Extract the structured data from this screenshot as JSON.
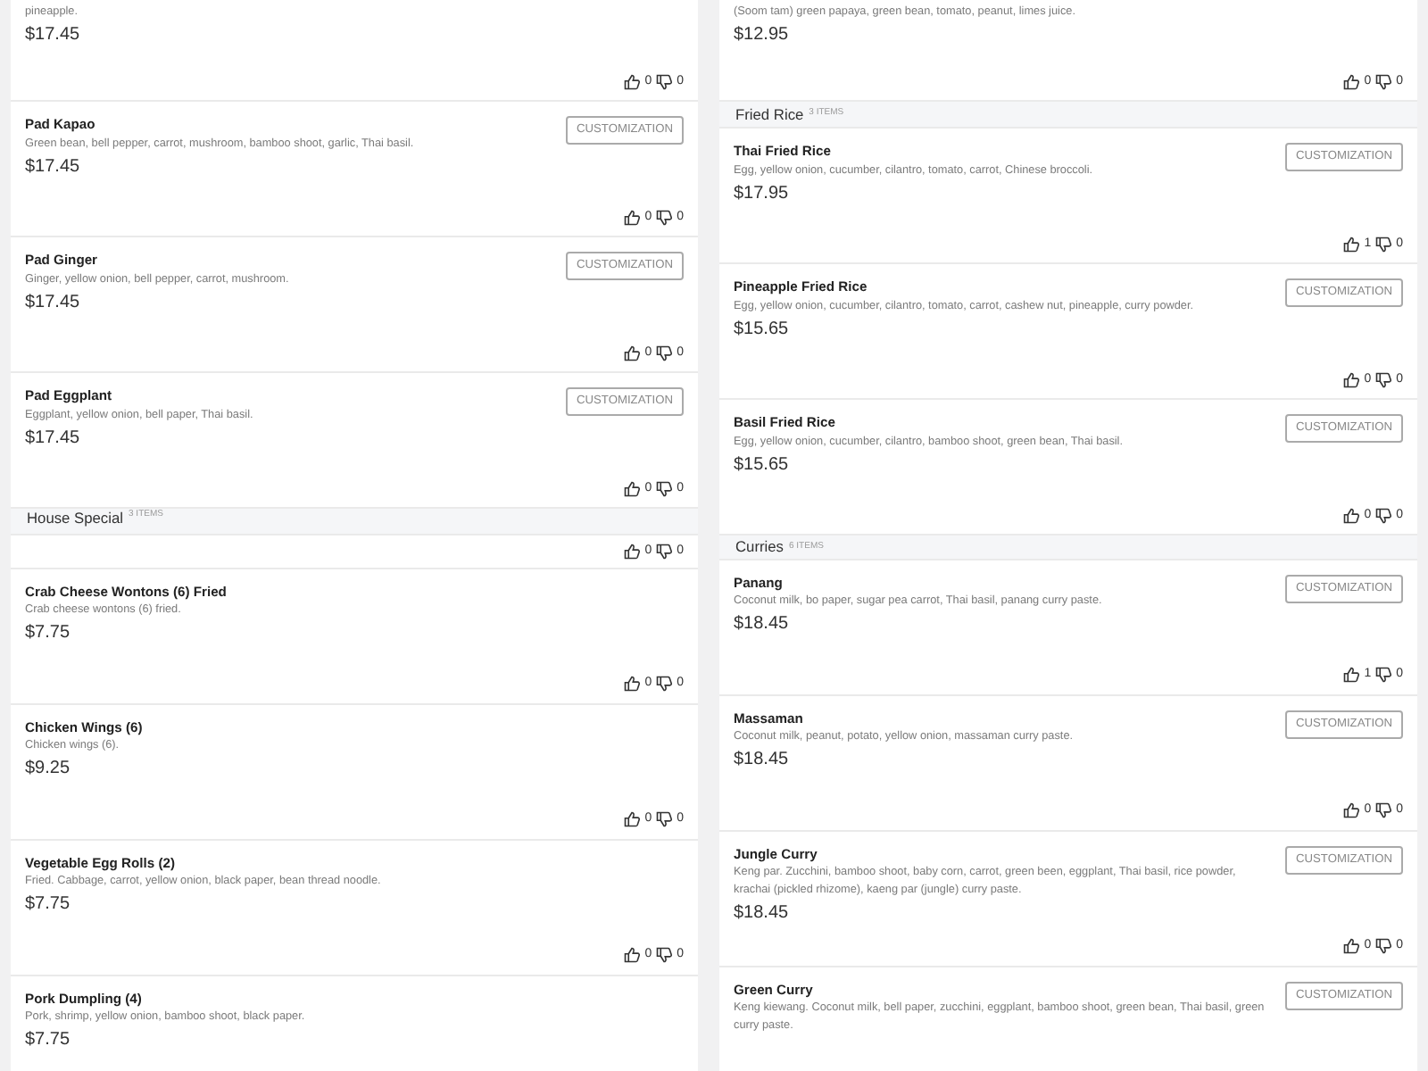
{
  "columns": [
    {
      "panels": [
        {
          "rows": [
            {
              "kind": "item",
              "description": "pineapple.",
              "price": "$17.45",
              "likes": "0",
              "dislikes": "0"
            },
            {
              "kind": "item",
              "name": "Pad Kapao",
              "description": "Green bean, bell pepper, carrot, mushroom, bamboo shoot, garlic, Thai basil.",
              "price": "$17.45",
              "button": "CUSTOMIZATION",
              "likes": "0",
              "dislikes": "0"
            },
            {
              "kind": "item",
              "name": "Pad Ginger",
              "description": "Ginger, yellow onion, bell pepper, carrot, mushroom.",
              "price": "$17.45",
              "button": "CUSTOMIZATION",
              "likes": "0",
              "dislikes": "0"
            },
            {
              "kind": "item",
              "name": "Pad Eggplant",
              "description": "Eggplant, yellow onion, bell paper, Thai basil.",
              "price": "$17.45",
              "button": "CUSTOMIZATION",
              "likes": "0",
              "dislikes": "0"
            },
            {
              "kind": "header",
              "title": "House Special",
              "count": "3 ITEMS"
            }
          ]
        },
        {
          "rows": [
            {
              "kind": "item",
              "likes": "0",
              "dislikes": "0"
            },
            {
              "kind": "item",
              "name": "Crab Cheese Wontons (6) Fried",
              "description": "Crab cheese wontons (6) fried.",
              "price": "$7.75",
              "likes": "0",
              "dislikes": "0"
            },
            {
              "kind": "item",
              "name": "Chicken Wings (6)",
              "description": "Chicken wings (6).",
              "price": "$9.25",
              "likes": "0",
              "dislikes": "0"
            },
            {
              "kind": "item",
              "name": "Vegetable Egg Rolls (2)",
              "description": "Fried. Cabbage, carrot, yellow onion, black paper, bean thread noodle.",
              "price": "$7.75",
              "likes": "0",
              "dislikes": "0"
            },
            {
              "kind": "item",
              "name": "Pork Dumpling (4)",
              "description": "Pork, shrimp, yellow onion, bamboo shoot, black paper.",
              "price": "$7.75"
            }
          ]
        }
      ]
    },
    {
      "panels": [
        {
          "rows": [
            {
              "kind": "item",
              "description": "(Soom tam) green papaya, green bean, tomato, peanut, limes juice.",
              "price": "$12.95",
              "likes": "0",
              "dislikes": "0"
            },
            {
              "kind": "header",
              "title": "Fried Rice",
              "count": "3 ITEMS"
            },
            {
              "kind": "item",
              "name": "Thai Fried Rice",
              "description": "Egg, yellow onion, cucumber, cilantro, tomato, carrot, Chinese broccoli.",
              "price": "$17.95",
              "button": "CUSTOMIZATION",
              "likes": "1",
              "dislikes": "0"
            },
            {
              "kind": "item",
              "name": "Pineapple Fried Rice",
              "description": "Egg, yellow onion, cucumber, cilantro, tomato, carrot, cashew nut, pineapple, curry powder.",
              "price": "$15.65",
              "button": "CUSTOMIZATION",
              "likes": "0",
              "dislikes": "0"
            },
            {
              "kind": "item",
              "name": "Basil Fried Rice",
              "description": "Egg, yellow onion, cucumber, cilantro, bamboo shoot, green bean, Thai basil.",
              "price": "$15.65",
              "button": "CUSTOMIZATION",
              "likes": "0",
              "dislikes": "0"
            }
          ]
        },
        {
          "rows": [
            {
              "kind": "header",
              "title": "Curries",
              "count": "6 ITEMS"
            },
            {
              "kind": "item",
              "name": "Panang",
              "description": "Coconut milk, bo paper, sugar pea carrot, Thai basil, panang curry paste.",
              "price": "$18.45",
              "button": "CUSTOMIZATION",
              "likes": "1",
              "dislikes": "0"
            },
            {
              "kind": "item",
              "name": "Massaman",
              "description": "Coconut milk, peanut, potato, yellow onion, massaman curry paste.",
              "price": "$18.45",
              "button": "CUSTOMIZATION",
              "likes": "0",
              "dislikes": "0"
            },
            {
              "kind": "item",
              "name": "Jungle Curry",
              "description": "Keng par. Zucchini, bamboo shoot, baby corn, carrot, green been, eggplant, Thai basil, rice powder, krachai (pickled rhizome), kaeng par (jungle) curry paste.",
              "price": "$18.45",
              "button": "CUSTOMIZATION",
              "likes": "0",
              "dislikes": "0"
            },
            {
              "kind": "item",
              "name": "Green Curry",
              "description": "Keng kiewang. Coconut milk, bell paper, zucchini, eggplant, bamboo shoot, green bean, Thai basil, green curry paste.",
              "button": "CUSTOMIZATION"
            }
          ]
        }
      ]
    }
  ]
}
